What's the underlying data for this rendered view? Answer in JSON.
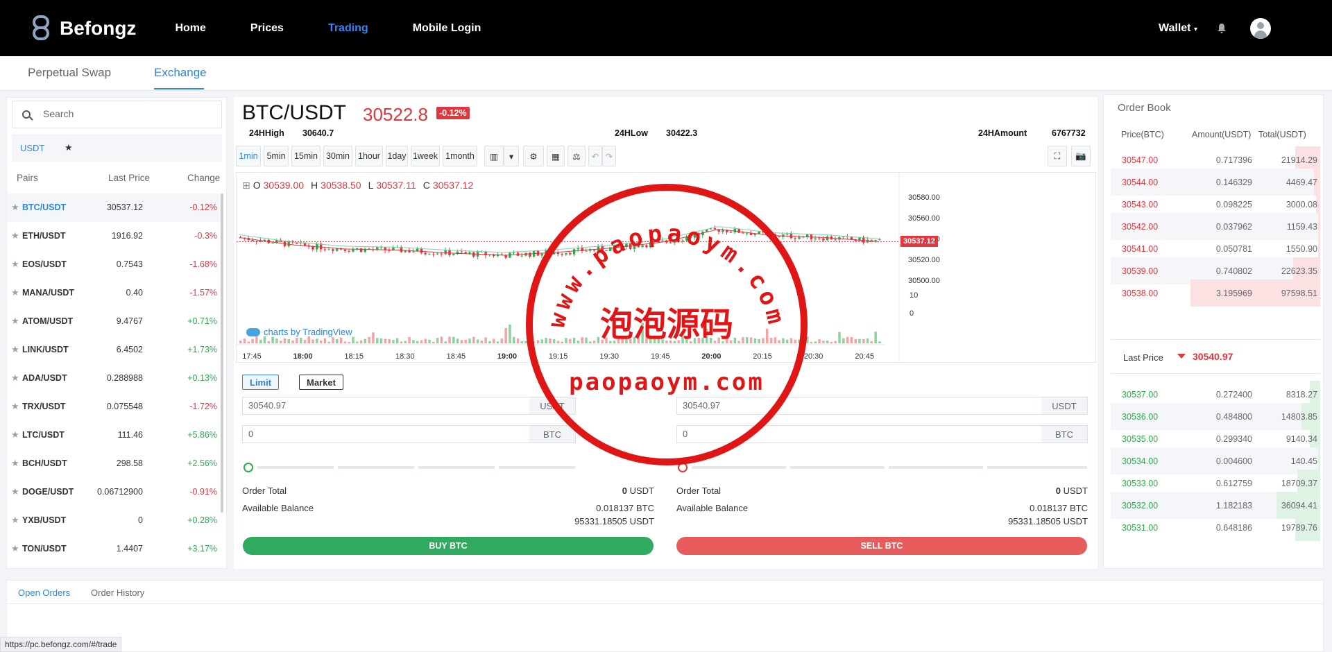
{
  "nav": {
    "brand": "Befongz",
    "links": [
      "Home",
      "Prices",
      "Trading",
      "Mobile Login"
    ],
    "active": "Trading",
    "wallet": "Wallet"
  },
  "subtabs": [
    "Perpetual Swap",
    "Exchange"
  ],
  "market": {
    "search_placeholder": "Search",
    "quote": "USDT",
    "favorites": "★",
    "headers": {
      "pair": "Pairs",
      "last": "Last Price",
      "change": "Change"
    },
    "rows": [
      {
        "pair": "BTC/USDT",
        "last": "30537.12",
        "change": "-0.12%"
      },
      {
        "pair": "ETH/USDT",
        "last": "1916.92",
        "change": "-0.3%"
      },
      {
        "pair": "EOS/USDT",
        "last": "0.7543",
        "change": "-1.68%"
      },
      {
        "pair": "MANA/USDT",
        "last": "0.40",
        "change": "-1.57%"
      },
      {
        "pair": "ATOM/USDT",
        "last": "9.4767",
        "change": "+0.71%"
      },
      {
        "pair": "LINK/USDT",
        "last": "6.4502",
        "change": "+1.73%"
      },
      {
        "pair": "ADA/USDT",
        "last": "0.288988",
        "change": "+0.13%"
      },
      {
        "pair": "TRX/USDT",
        "last": "0.075548",
        "change": "-1.72%"
      },
      {
        "pair": "LTC/USDT",
        "last": "111.46",
        "change": "+5.86%"
      },
      {
        "pair": "BCH/USDT",
        "last": "298.58",
        "change": "+2.56%"
      },
      {
        "pair": "DOGE/USDT",
        "last": "0.06712900",
        "change": "-0.91%"
      },
      {
        "pair": "YXB/USDT",
        "last": "0",
        "change": "+0.28%"
      },
      {
        "pair": "TON/USDT",
        "last": "1.4407",
        "change": "+3.17%"
      }
    ]
  },
  "ticker": {
    "symbol": "BTC/USDT",
    "price": "30522.8",
    "change": "-0.12%",
    "high_label": "24HHigh",
    "high": "30640.7",
    "low_label": "24HLow",
    "low": "30422.3",
    "amount_label": "24HAmount",
    "amount": "6767732"
  },
  "intervals": [
    "1min",
    "5min",
    "15min",
    "30min",
    "1hour",
    "1day",
    "1week",
    "1month"
  ],
  "chart": {
    "ohlc": {
      "o": "30539.00",
      "h": "30538.50",
      "l": "30537.11",
      "c": "30537.12"
    },
    "price_tag": "30537.12",
    "attribution": "charts by TradingView",
    "y_ticks": [
      "30580.00",
      "30560.00",
      "30540.00",
      "30520.00",
      "30500.00"
    ],
    "vol_ticks": [
      "10",
      "0"
    ],
    "x_ticks": [
      "17:45",
      "18:00",
      "18:15",
      "18:30",
      "18:45",
      "19:00",
      "19:15",
      "19:30",
      "19:45",
      "20:00",
      "20:15",
      "20:30",
      "20:45"
    ]
  },
  "chart_data": {
    "type": "candlestick",
    "x": [
      "17:45",
      "18:00",
      "18:15",
      "18:30",
      "18:45",
      "19:00",
      "19:15",
      "19:30",
      "19:45",
      "20:00",
      "20:15",
      "20:30",
      "20:45"
    ],
    "close": [
      30541,
      30534,
      30530,
      30529,
      30526,
      30524,
      30527,
      30531,
      30537,
      30549,
      30543,
      30541,
      30537.12
    ],
    "ylim": [
      30490,
      30590
    ]
  },
  "order": {
    "types": [
      "Limit",
      "Market"
    ],
    "buy": {
      "price": "30540.97",
      "amount": "0",
      "price_unit": "USDT",
      "amount_unit": "BTC",
      "total_label": "Order Total",
      "total": "0",
      "total_unit": "USDT",
      "balance_label": "Available Balance",
      "balance_btc": "0.018137 BTC",
      "balance_usdt": "95331.18505 USDT",
      "button": "BUY BTC"
    },
    "sell": {
      "price": "30540.97",
      "amount": "0",
      "price_unit": "USDT",
      "amount_unit": "BTC",
      "total_label": "Order Total",
      "total": "0",
      "total_unit": "USDT",
      "balance_label": "Available Balance",
      "balance_btc": "0.018137 BTC",
      "balance_usdt": "95331.18505 USDT",
      "button": "SELL BTC"
    }
  },
  "book": {
    "title": "Order Book",
    "headers": {
      "price": "Price(BTC)",
      "amount": "Amount(USDT)",
      "total": "Total(USDT)"
    },
    "asks": [
      {
        "price": "30547.00",
        "amount": "0.717396",
        "total": "21914.29",
        "depth": 0.12
      },
      {
        "price": "30544.00",
        "amount": "0.146329",
        "total": "4469.47",
        "depth": 0.03
      },
      {
        "price": "30543.00",
        "amount": "0.098225",
        "total": "3000.08",
        "depth": 0.02
      },
      {
        "price": "30542.00",
        "amount": "0.037962",
        "total": "1159.43",
        "depth": 0.01
      },
      {
        "price": "30541.00",
        "amount": "0.050781",
        "total": "1550.90",
        "depth": 0.01
      },
      {
        "price": "30539.00",
        "amount": "0.740802",
        "total": "22623.35",
        "depth": 0.13
      },
      {
        "price": "30538.00",
        "amount": "3.195969",
        "total": "97598.51",
        "depth": 0.62
      }
    ],
    "last_label": "Last Price",
    "last_price": "30540.97",
    "bids": [
      {
        "price": "30537.00",
        "amount": "0.272400",
        "total": "8318.27",
        "depth": 0.05
      },
      {
        "price": "30536.00",
        "amount": "0.484800",
        "total": "14803.85",
        "depth": 0.09
      },
      {
        "price": "30535.00",
        "amount": "0.299340",
        "total": "9140.34",
        "depth": 0.05
      },
      {
        "price": "30534.00",
        "amount": "0.004600",
        "total": "140.45",
        "depth": 0.01
      },
      {
        "price": "30533.00",
        "amount": "0.612759",
        "total": "18709.37",
        "depth": 0.11
      },
      {
        "price": "30532.00",
        "amount": "1.182183",
        "total": "36094.41",
        "depth": 0.21
      },
      {
        "price": "30531.00",
        "amount": "0.648186",
        "total": "19789.76",
        "depth": 0.12
      }
    ]
  },
  "bottom_tabs": [
    "Open Orders",
    "Order History"
  ],
  "status_url": "https://pc.befongz.com/#/trade",
  "watermark": {
    "arc": "www.paopaoym.com",
    "cn": "泡泡源码",
    "url": "paopaoym.com"
  }
}
